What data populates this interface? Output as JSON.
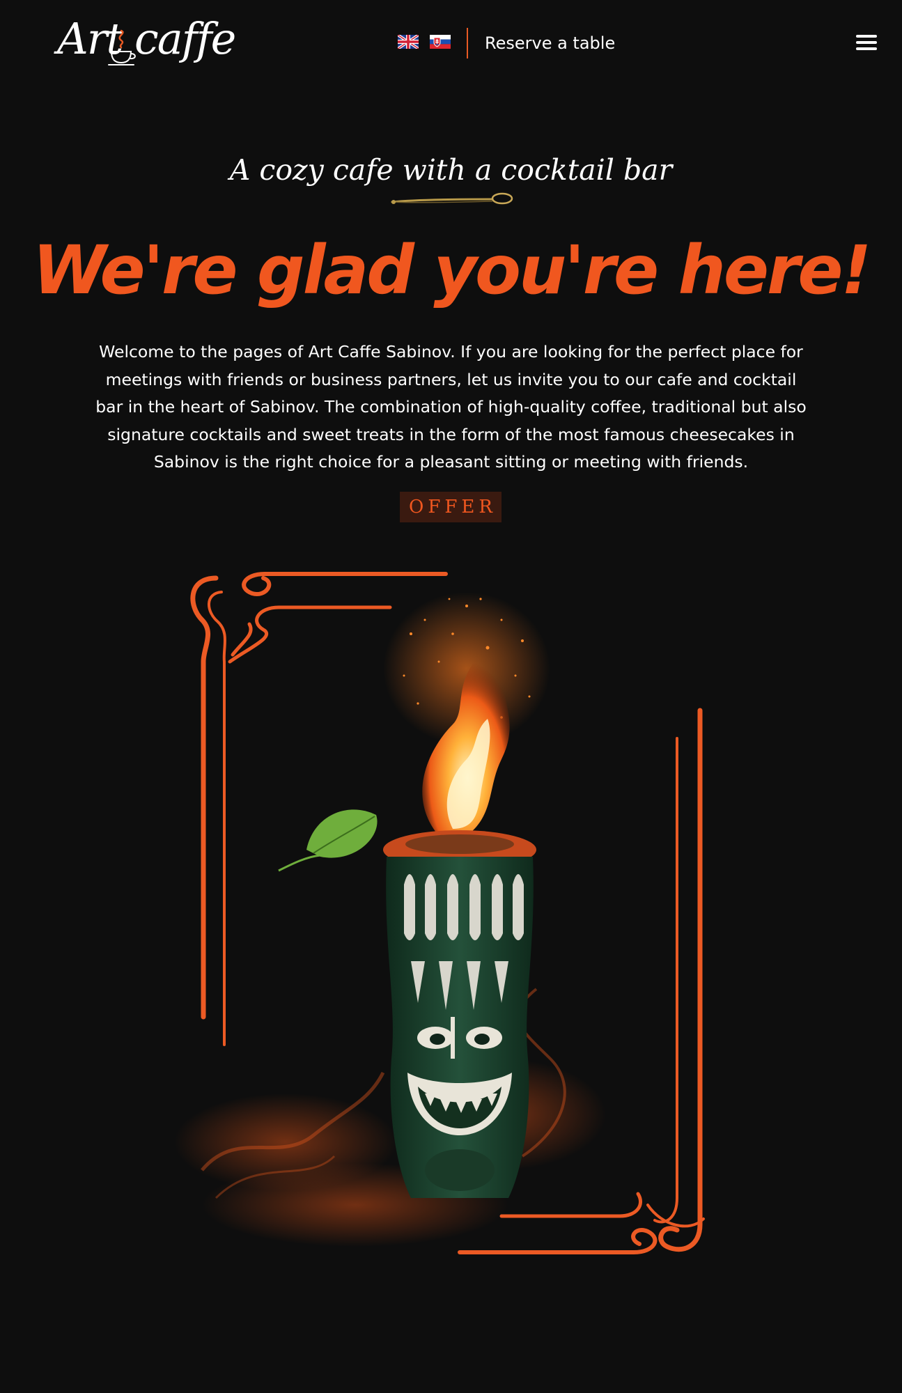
{
  "header": {
    "logo": {
      "text": "Art caffe",
      "icon": "coffee-cup-icon"
    },
    "languages": [
      {
        "code": "en",
        "icon": "uk-flag-icon",
        "active": true
      },
      {
        "code": "sk",
        "icon": "slovakia-flag-icon",
        "active": false
      }
    ],
    "reserve_label": "Reserve a table",
    "menu_icon": "hamburger-menu-icon"
  },
  "hero": {
    "subtitle": "A cozy cafe with a cocktail bar",
    "divider_icon": "spoon-icon",
    "headline": "We're glad you're here!",
    "intro": "Welcome to the pages of Art Caffe Sabinov. If you are looking for the perfect place for meetings with friends or business partners, let us invite you to our cafe and cocktail bar in the heart of Sabinov. The combination of high-quality coffee, traditional but also signature cocktails and sweet treats in the form of the most famous cheesecakes in Sabinov is the right choice for a pleasant sitting or meeting with friends.",
    "offer_label": "OFFER"
  },
  "image": {
    "subject": "flaming tiki cocktail in ornate orange frame"
  },
  "colors": {
    "background": "#0e0e0e",
    "accent": "#f0571f",
    "text": "#ffffff",
    "button_bg": "#3a1a10"
  }
}
